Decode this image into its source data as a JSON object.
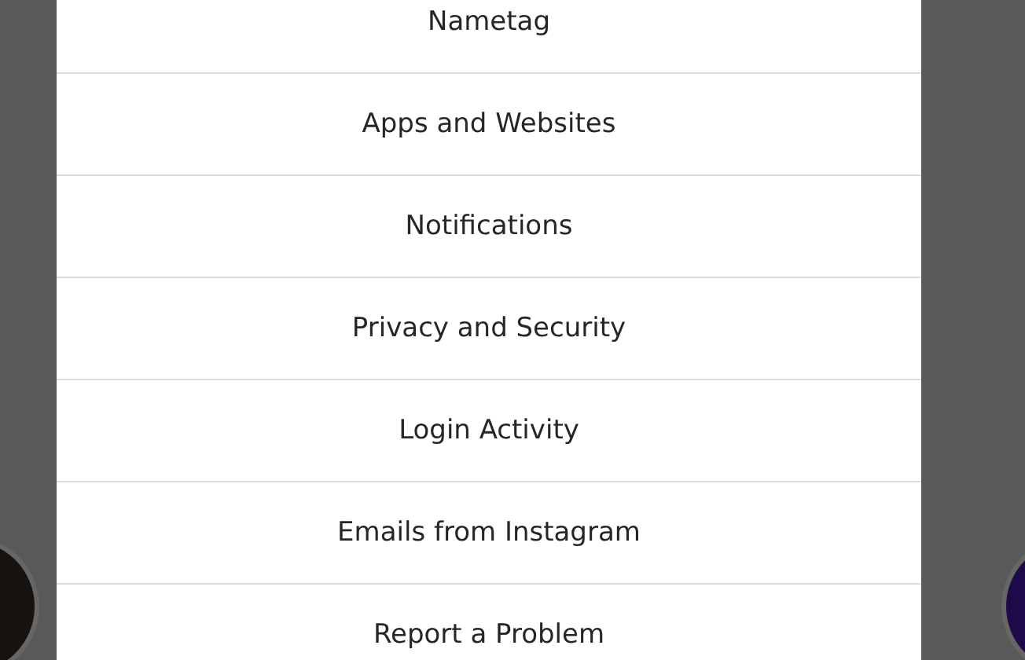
{
  "menu": {
    "items": [
      {
        "label": "Nametag"
      },
      {
        "label": "Apps and Websites"
      },
      {
        "label": "Notifications"
      },
      {
        "label": "Privacy and Security"
      },
      {
        "label": "Login Activity"
      },
      {
        "label": "Emails from Instagram"
      },
      {
        "label": "Report a Problem"
      }
    ]
  }
}
